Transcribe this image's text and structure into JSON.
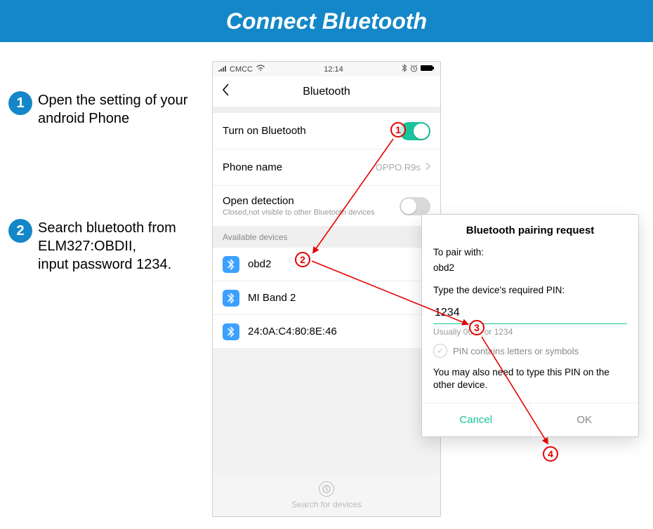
{
  "banner": {
    "title": "Connect Bluetooth"
  },
  "instructions": {
    "step1": {
      "num": "1",
      "text": "Open the setting of your android Phone"
    },
    "step2": {
      "num": "2",
      "text": "Search bluetooth from ELM327:OBDII,\ninput password 1234."
    }
  },
  "phone": {
    "status": {
      "carrier": "CMCC",
      "time": "12:14"
    },
    "title": "Bluetooth",
    "rows": {
      "turn_on": {
        "label": "Turn on Bluetooth"
      },
      "phone_name": {
        "label": "Phone name",
        "value": "OPPO R9s"
      },
      "open_detection": {
        "label": "Open detection",
        "sub": "Closed,not visible to other Bluetooth devices"
      }
    },
    "section": "Available devices",
    "devices": [
      {
        "name": "obd2"
      },
      {
        "name": "MI Band 2"
      },
      {
        "name": "24:0A:C4:80:8E:46"
      }
    ],
    "search_label": "Search for devices"
  },
  "dialog": {
    "title": "Bluetooth pairing request",
    "pair_with_label": "To pair with:",
    "pair_with_device": "obd2",
    "type_pin_label": "Type the device's required PIN:",
    "pin": "1234",
    "hint": "Usually 0000 or 1234",
    "checkbox_label": "PIN contains letters or symbols",
    "note": "You may also need to type this PIN on the other device.",
    "cancel": "Cancel",
    "ok": "OK"
  },
  "annotations": {
    "a1": "1",
    "a2": "2",
    "a3": "3",
    "a4": "4"
  }
}
